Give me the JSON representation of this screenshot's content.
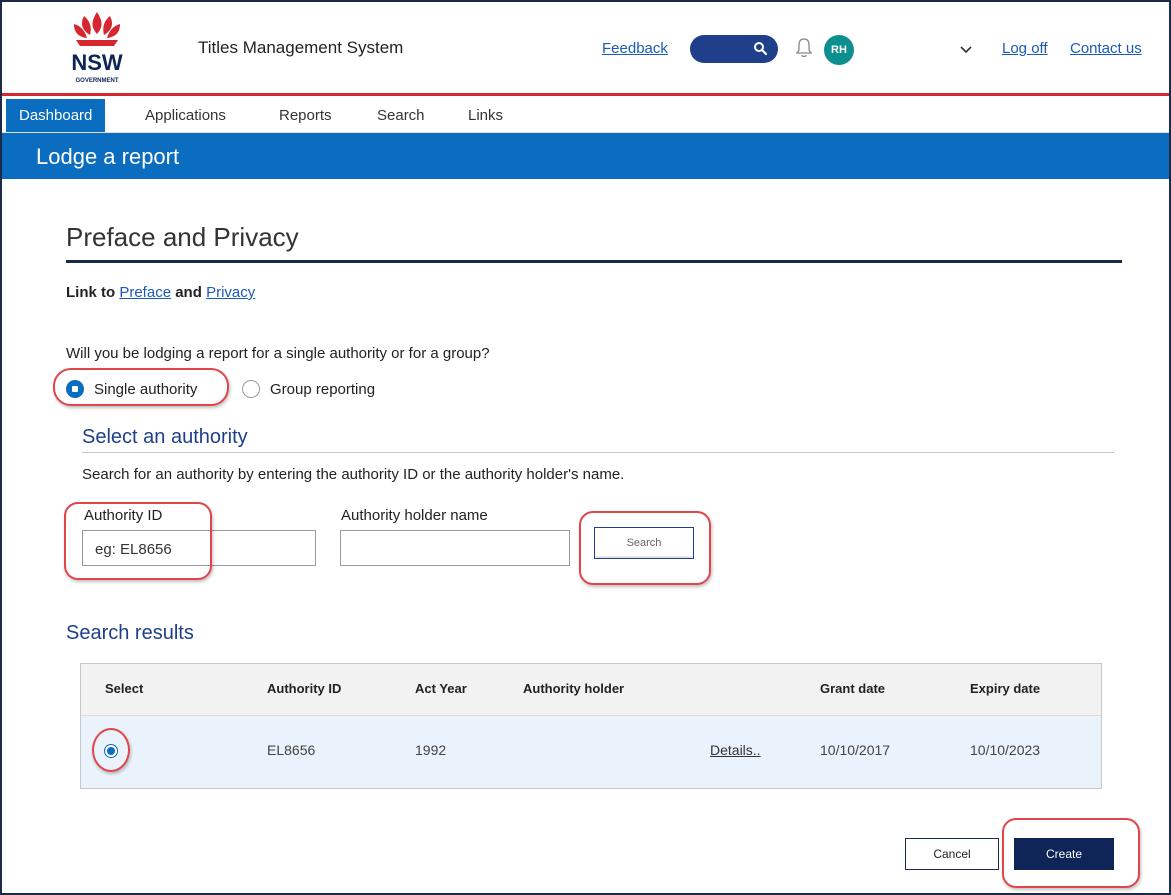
{
  "header": {
    "logo_text": "NSW",
    "logo_subtext": "GOVERNMENT",
    "app_title": "Titles Management System",
    "feedback_label": "Feedback",
    "user_initials": "RH",
    "logoff_label": "Log off",
    "contact_label": "Contact us"
  },
  "nav": {
    "items": [
      {
        "label": "Dashboard",
        "active": true
      },
      {
        "label": "Applications"
      },
      {
        "label": "Reports"
      },
      {
        "label": "Search"
      },
      {
        "label": "Links"
      }
    ]
  },
  "banner": {
    "title": "Lodge a report"
  },
  "preface": {
    "heading": "Preface and Privacy",
    "link_prefix": "Link to",
    "preface_link": "Preface",
    "and_text": "and",
    "privacy_link": "Privacy"
  },
  "reporting": {
    "question": "Will you be lodging a report for a single authority or for a group?",
    "options": [
      {
        "label": "Single authority",
        "selected": true
      },
      {
        "label": "Group reporting",
        "selected": false
      }
    ]
  },
  "select_authority": {
    "heading": "Select an authority",
    "hint": "Search for an authority by entering the authority ID or the authority holder's name.",
    "authority_id_label": "Authority ID",
    "authority_id_value": "eg: EL8656",
    "holder_name_label": "Authority holder name",
    "holder_name_value": "",
    "search_button": "Search"
  },
  "results": {
    "heading": "Search results",
    "columns": [
      "Select",
      "Authority ID",
      "Act Year",
      "Authority holder",
      "Grant date",
      "Expiry date"
    ],
    "rows": [
      {
        "authority_id": "EL8656",
        "act_year": "1992",
        "authority_holder": "",
        "details_link": "Details..",
        "grant_date": "10/10/2017",
        "expiry_date": "10/10/2023",
        "selected": true
      }
    ]
  },
  "actions": {
    "cancel": "Cancel",
    "create": "Create"
  },
  "colors": {
    "nav_blue": "#0a6dbf",
    "navy": "#0f2557",
    "accent_red": "#d6262f",
    "highlight": "#e0454a"
  }
}
